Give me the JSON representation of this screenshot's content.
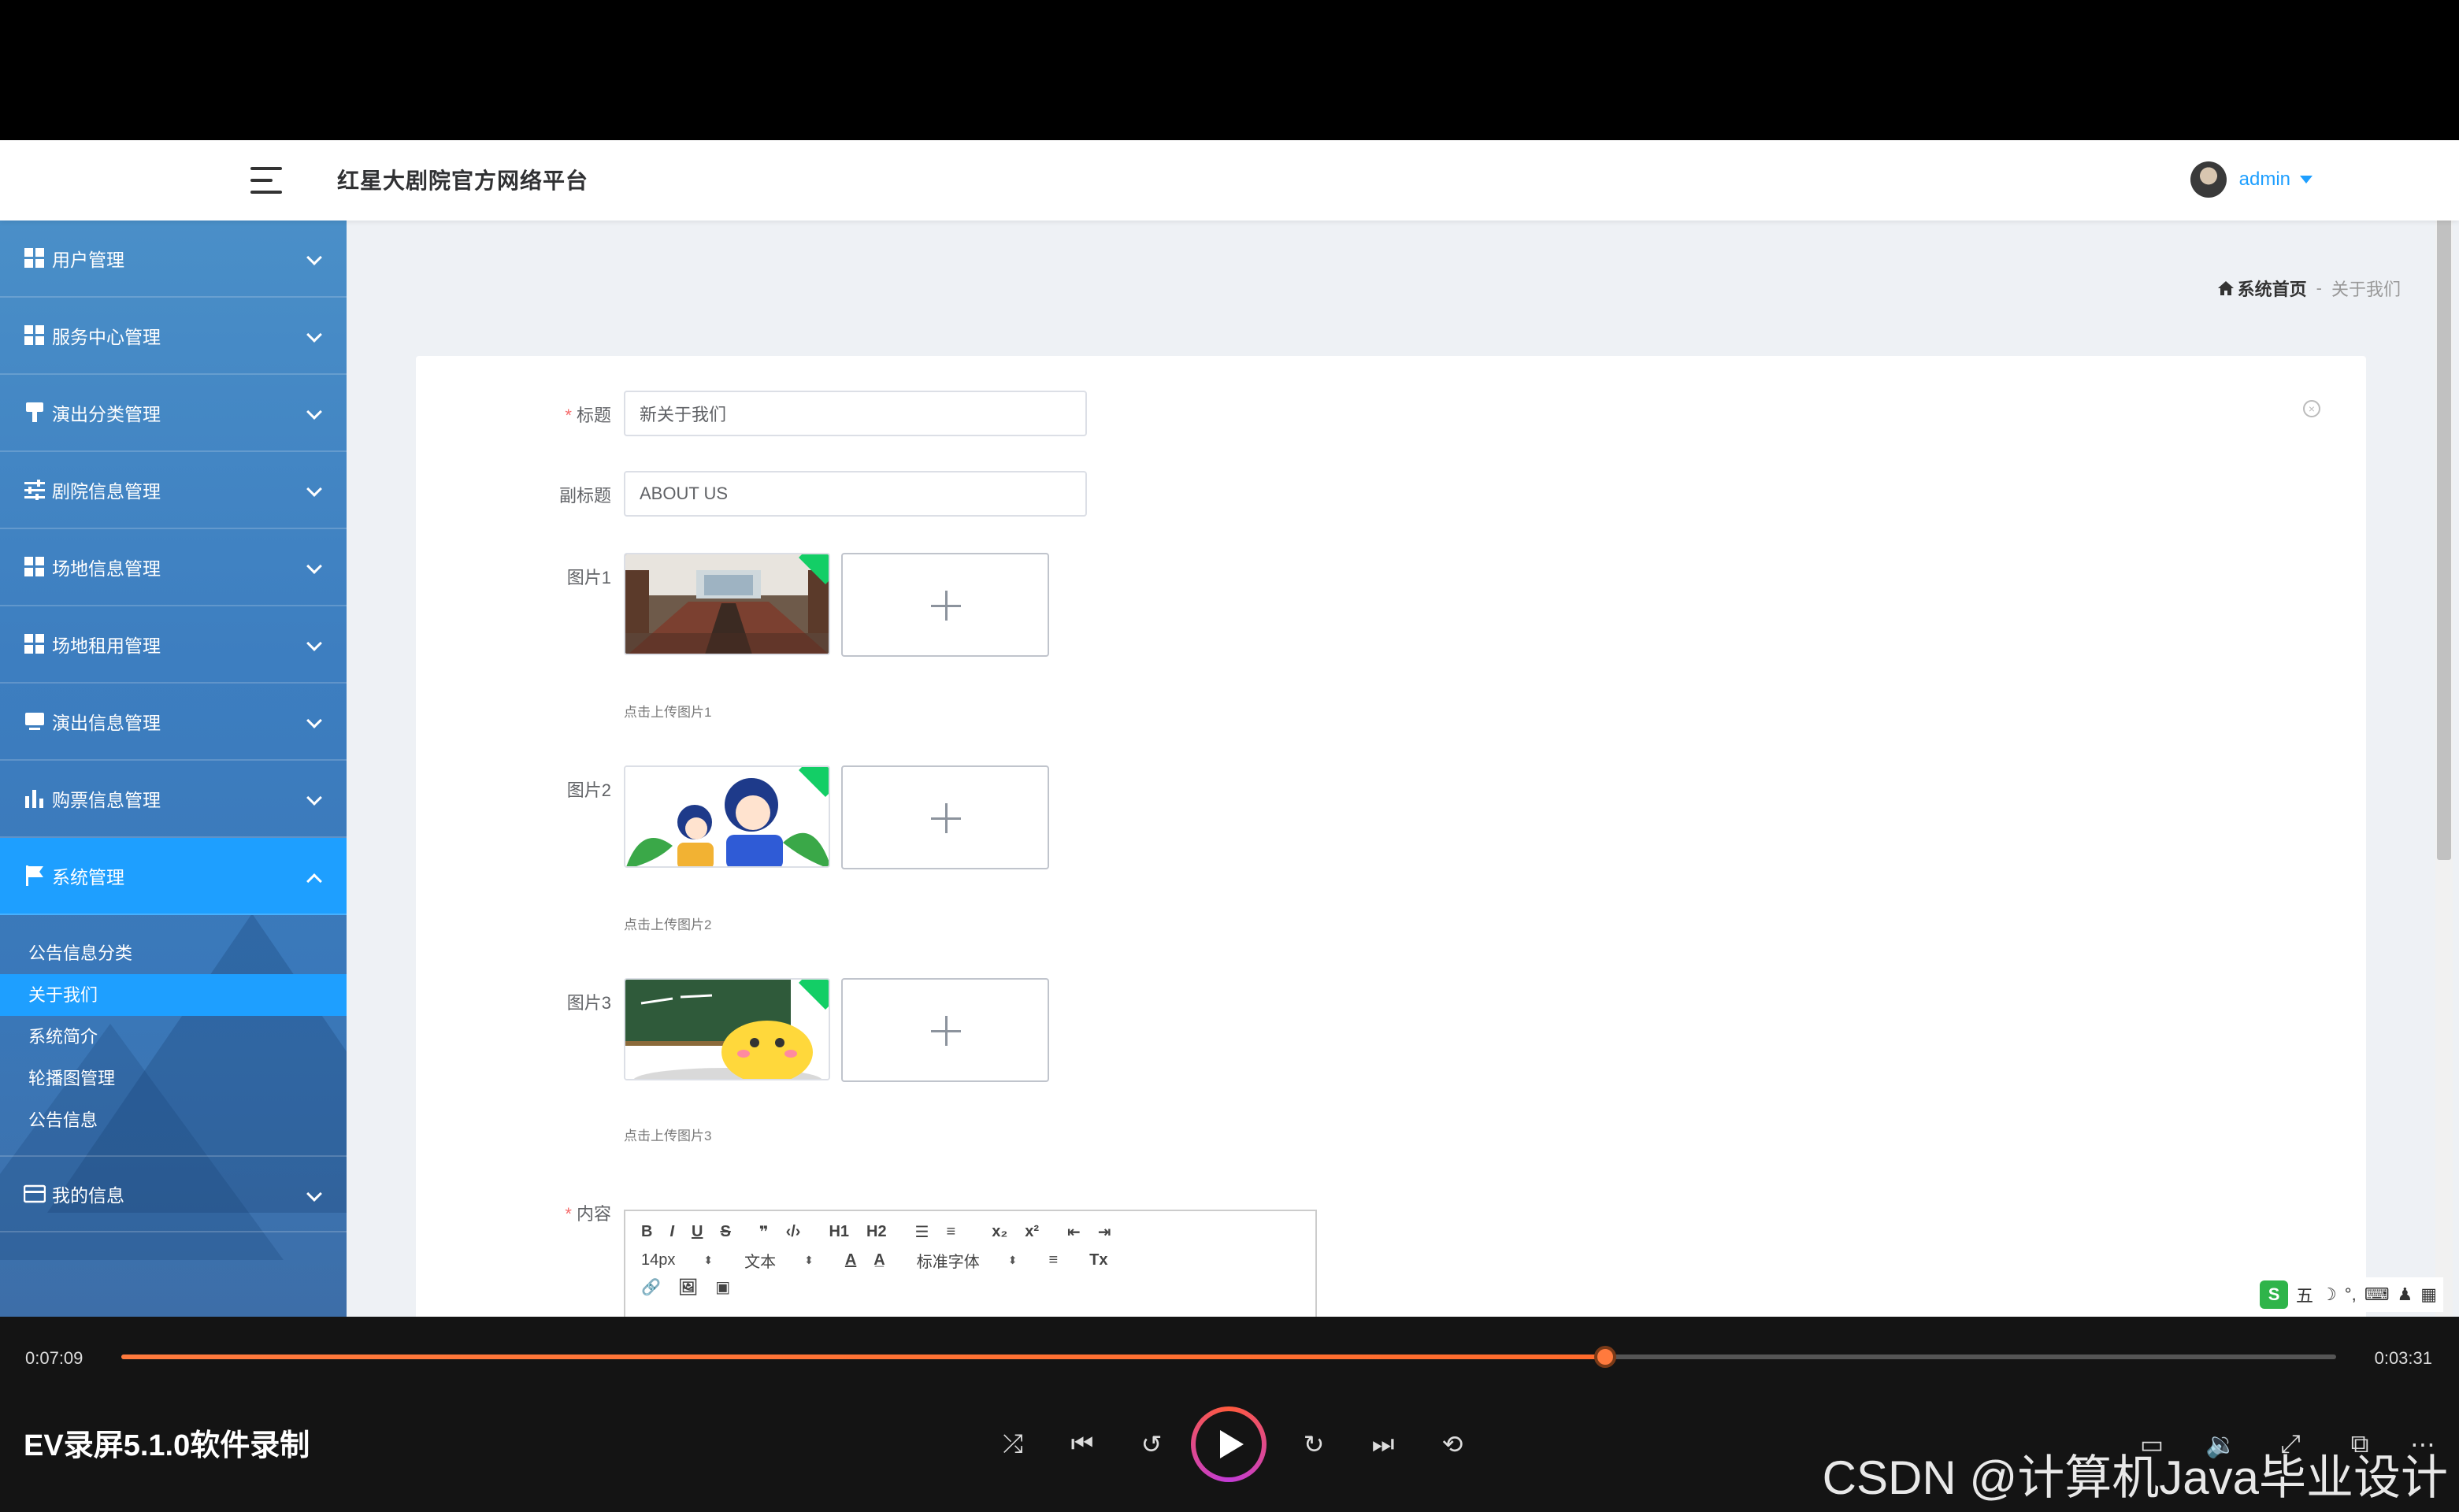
{
  "app": {
    "title": "红星大剧院官方网络平台",
    "user": "admin"
  },
  "sidebar": {
    "items": [
      {
        "label": "用户管理",
        "icon": "grid-icon"
      },
      {
        "label": "服务中心管理",
        "icon": "grid-icon"
      },
      {
        "label": "演出分类管理",
        "icon": "brush-icon"
      },
      {
        "label": "剧院信息管理",
        "icon": "sliders-icon"
      },
      {
        "label": "场地信息管理",
        "icon": "grid-icon"
      },
      {
        "label": "场地租用管理",
        "icon": "grid-icon"
      },
      {
        "label": "演出信息管理",
        "icon": "monitor-icon"
      },
      {
        "label": "购票信息管理",
        "icon": "bar-chart-icon"
      },
      {
        "label": "系统管理",
        "icon": "flag-icon"
      }
    ],
    "submenu": [
      "公告信息分类",
      "关于我们",
      "系统简介",
      "轮播图管理",
      "公告信息"
    ],
    "last_item": {
      "label": "我的信息",
      "icon": "card-icon"
    }
  },
  "breadcrumb": {
    "home": "系统首页",
    "separator": "-",
    "current": "关于我们"
  },
  "form": {
    "title_label": "标题",
    "title_value": "新关于我们",
    "subtitle_label": "副标题",
    "subtitle_value": "ABOUT US",
    "images": [
      {
        "label": "图片1",
        "hint": "点击上传图片1"
      },
      {
        "label": "图片2",
        "hint": "点击上传图片2"
      },
      {
        "label": "图片3",
        "hint": "点击上传图片3"
      }
    ],
    "content_label": "内容",
    "required_mark": "*"
  },
  "editor": {
    "row1": [
      "B",
      "I",
      "U",
      "S",
      "❞",
      "‹/›",
      "H1",
      "H2",
      "☰",
      "≡",
      "x₂",
      "x²",
      "⇤",
      "⇥"
    ],
    "font_size": "14px",
    "block_type": "文本",
    "font_family": "标准字体",
    "row2_tools": [
      "A",
      "A̲",
      "≡",
      "Tx"
    ],
    "row3": [
      "🔗",
      "🖼",
      "▣"
    ]
  },
  "ime": {
    "logo": "S",
    "items": [
      "五",
      "☽",
      "°,",
      "⌨",
      "♟",
      "▦"
    ]
  },
  "player": {
    "elapsed": "0:07:09",
    "remaining": "0:03:31",
    "progress": 0.67,
    "title": "EV录屏5.1.0软件录制",
    "watermark": "CSDN @计算机Java毕业设计"
  },
  "colors": {
    "accent": "#1e9fff",
    "sidebar": "#3d7ec0",
    "progress": "#ff7a3d"
  }
}
